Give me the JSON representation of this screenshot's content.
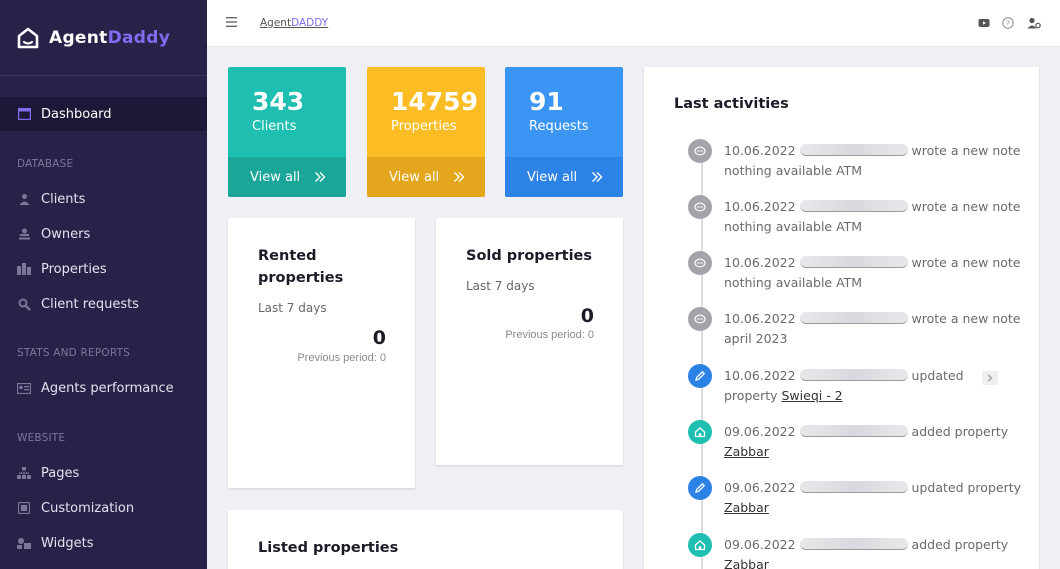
{
  "brand": {
    "part1": "Agent",
    "part2": "Daddy"
  },
  "sidebar": {
    "dashboard": "Dashboard",
    "section_database": "DATABASE",
    "clients": "Clients",
    "owners": "Owners",
    "properties": "Properties",
    "client_requests": "Client requests",
    "section_stats": "STATS AND REPORTS",
    "agents_performance": "Agents performance",
    "section_website": "WEBSITE",
    "pages": "Pages",
    "customization": "Customization",
    "widgets": "Widgets"
  },
  "topbar": {
    "crumb1": "Agent",
    "crumb2": "DADDY"
  },
  "stats": [
    {
      "value": "343",
      "label": "Clients",
      "link": "View all"
    },
    {
      "value": "14759",
      "label": "Properties",
      "link": "View all"
    },
    {
      "value": "91",
      "label": "Requests",
      "link": "View all"
    }
  ],
  "rented": {
    "title": "Rented properties",
    "period": "Last 7 days",
    "value": "0",
    "previous": "Previous period: 0"
  },
  "sold": {
    "title": "Sold properties",
    "period": "Last 7 days",
    "value": "0",
    "previous": "Previous period: 0"
  },
  "listed": {
    "title": "Listed properties"
  },
  "activities": {
    "title": "Last activities",
    "items": [
      {
        "date": "10.06.2022",
        "action": "wrote a new",
        "rest": "note nothing available ATM"
      },
      {
        "date": "10.06.2022",
        "action": "wrote a new",
        "rest": "note nothing available ATM"
      },
      {
        "date": "10.06.2022",
        "action": "wrote a new",
        "rest": "note nothing available ATM"
      },
      {
        "date": "10.06.2022",
        "action": "wrote a new",
        "rest": "note april 2023"
      },
      {
        "date": "10.06.2022",
        "action": "updated",
        "rest": "property",
        "link": "Swieqi - 2"
      },
      {
        "date": "09.06.2022",
        "action": "added property",
        "link": "Zabbar"
      },
      {
        "date": "09.06.2022",
        "action": "updated property",
        "link": "Zabbar"
      },
      {
        "date": "09.06.2022",
        "action": "added property",
        "link": "Zabbar"
      }
    ]
  },
  "colors": {
    "sidebar": "#2a2149",
    "accent": "#7f6cf0",
    "teal": "#1ebfb0",
    "amber": "#fbbd23",
    "blue": "#3b95f5"
  }
}
